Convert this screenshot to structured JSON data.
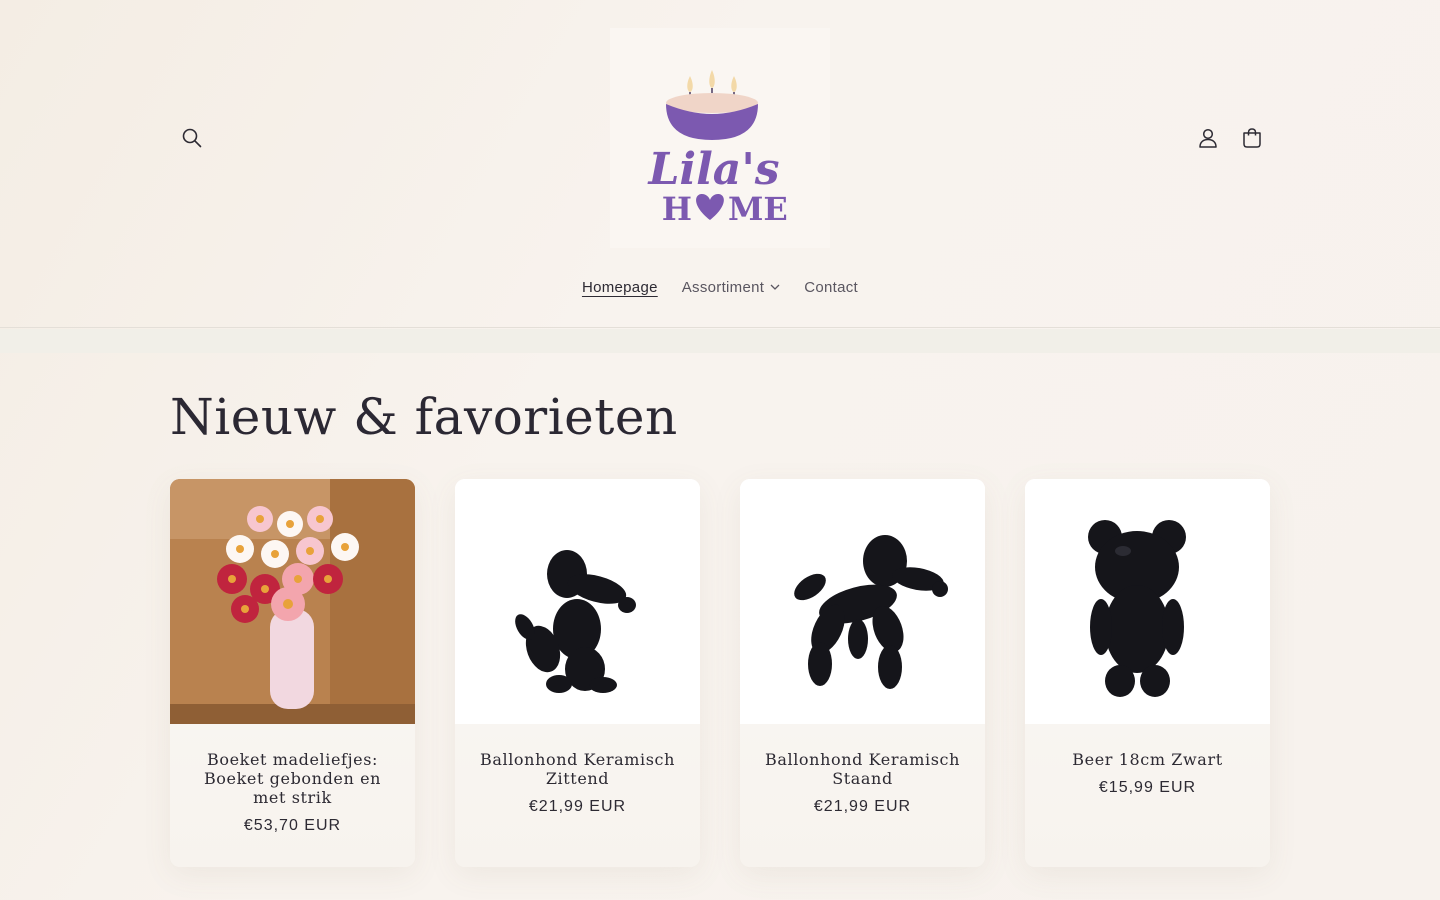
{
  "header": {
    "logo": {
      "line1": "Lila's",
      "line2_prefix": "H",
      "line2_suffix": "ME"
    },
    "nav": [
      {
        "label": "Homepage"
      },
      {
        "label": "Assortiment"
      },
      {
        "label": "Contact"
      }
    ]
  },
  "section": {
    "title": "Nieuw & favorieten"
  },
  "products": [
    {
      "title": "Boeket madeliefjes: Boeket gebonden en met strik",
      "price": "€53,70 EUR",
      "image": "flower-bouquet"
    },
    {
      "title": "Ballonhond Keramisch Zittend",
      "price": "€21,99 EUR",
      "image": "balloon-dog-sitting"
    },
    {
      "title": "Ballonhond Keramisch Staand",
      "price": "€21,99 EUR",
      "image": "balloon-dog-standing"
    },
    {
      "title": "Beer 18cm Zwart",
      "price": "€15,99 EUR",
      "image": "black-bear-figurine"
    }
  ],
  "colors": {
    "brand_purple": "#7c59b0",
    "text": "#2d2a33",
    "background": "#f6f1eb"
  }
}
